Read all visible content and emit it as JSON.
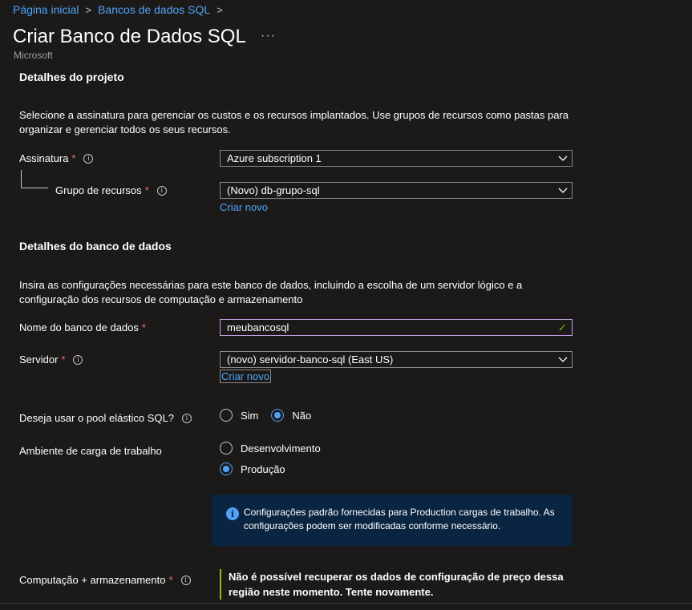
{
  "breadcrumb": {
    "home": "Página inicial",
    "sql_dbs": "Bancos de dados SQL",
    "sep": ">"
  },
  "page": {
    "title": "Criar Banco de Dados SQL",
    "more": "···",
    "publisher": "Microsoft"
  },
  "project": {
    "heading": "Detalhes do projeto",
    "description": "Selecione a assinatura para gerenciar os custos e os recursos implantados. Use grupos de recursos como pastas para organizar e gerenciar todos os seus recursos.",
    "subscription_label": "Assinatura",
    "subscription_value": "Azure subscription 1",
    "rg_label": "Grupo de recursos",
    "rg_value": "(Novo) db-grupo-sql",
    "rg_create": "Criar novo"
  },
  "database": {
    "heading": "Detalhes do banco de dados",
    "description": "Insira as configurações necessárias para este banco de dados, incluindo a escolha de um servidor lógico e a configuração dos recursos de computação e armazenamento",
    "name_label": "Nome do banco de dados",
    "name_value": "meubancosql",
    "server_label": "Servidor",
    "server_value": "(novo) servidor-banco-sql (East US)",
    "server_create": "Criar novo",
    "pool_label": "Deseja usar o pool elástico SQL?",
    "pool_yes": "Sim",
    "pool_no": "Não",
    "pool_selected": "Não",
    "workload_label": "Ambiente de carga de trabalho",
    "workload_dev": "Desenvolvimento",
    "workload_prod": "Produção",
    "workload_selected": "Produção",
    "info_message": "Configurações padrão fornecidas para Production cargas de trabalho. As configurações podem ser modificadas conforme necessário.",
    "compute_label": "Computação + armazenamento",
    "compute_warning": "Não é possível recuperar os dados de configuração de preço dessa região neste momento. Tente novamente."
  },
  "required_mark": "*",
  "colors": {
    "accent": "#4fa3f7",
    "required": "#f1707b",
    "valid": "#6bb700",
    "info_bg": "#0a2541",
    "warning_bar": "#8cbd18"
  }
}
